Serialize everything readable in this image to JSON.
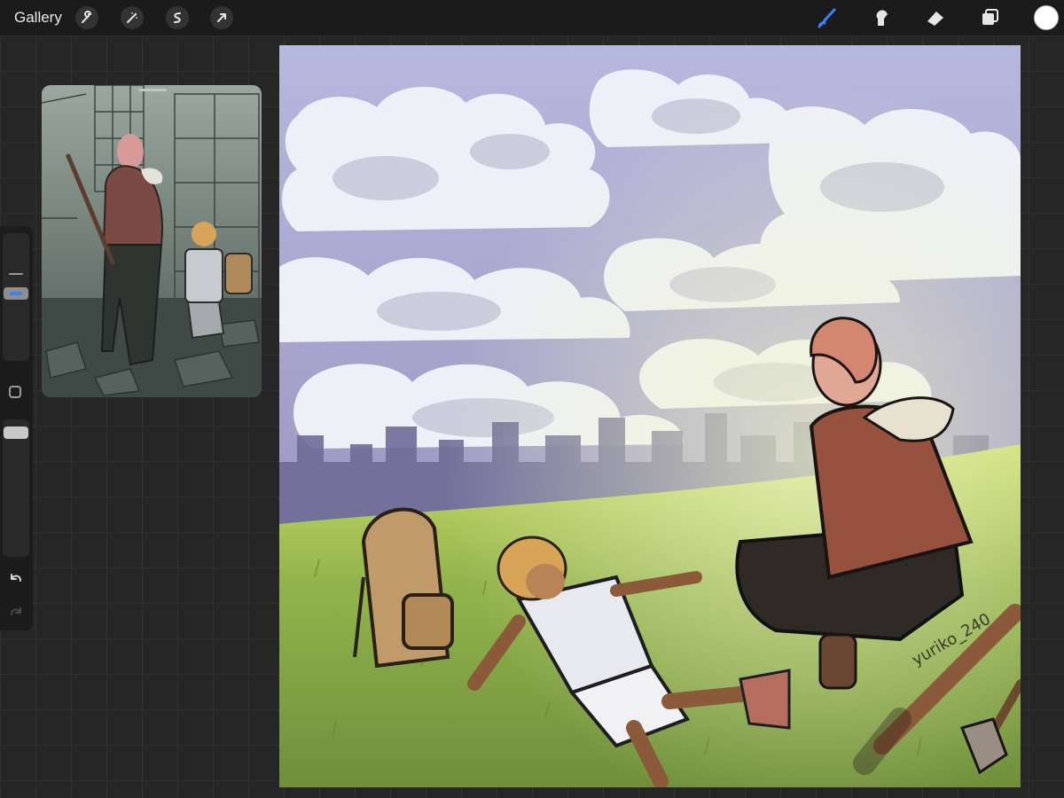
{
  "topbar": {
    "gallery_label": "Gallery",
    "left_tools": [
      "wrench-icon",
      "magic-wand-icon",
      "selection-icon",
      "transform-arrow-icon"
    ],
    "right_tools": [
      "brush-icon",
      "smudge-icon",
      "eraser-icon",
      "layers-icon"
    ],
    "active_tool": "brush",
    "accent_color": "#3b82f6",
    "current_color": "#ffffff"
  },
  "sidebar": {
    "brush_size_icon": "size-slider",
    "opacity_icon": "opacity-slider",
    "undo_icon": "undo-arrow-icon",
    "redo_icon": "redo-arrow-icon"
  },
  "canvas": {
    "signature": "yuriko_240"
  },
  "colors": {
    "sky_top": "#b9b9dc",
    "sky_bottom": "#8d8ab6",
    "cloud": "#eef0f7",
    "city": "#6c6a92",
    "grass": "#8fb24a"
  }
}
